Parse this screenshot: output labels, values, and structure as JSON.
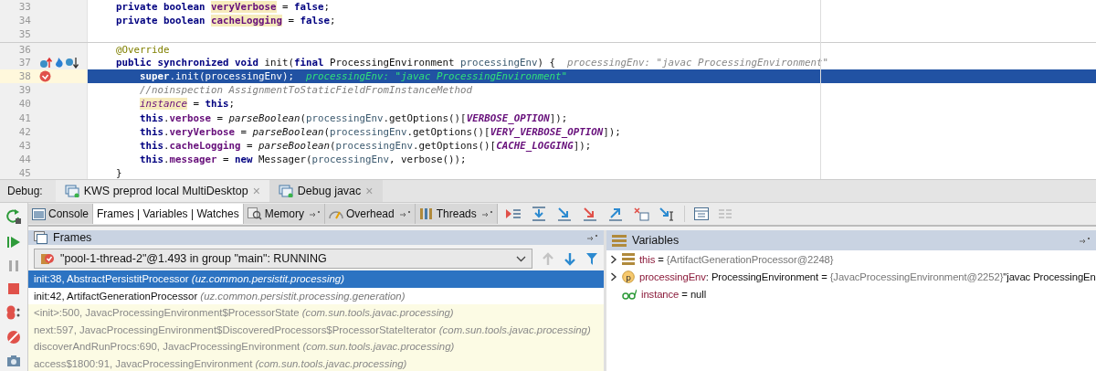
{
  "editor": {
    "lines": [
      {
        "number": "33",
        "kind": "member",
        "selected": false,
        "breakpoint": false,
        "method_markers": false,
        "segments": [
          {
            "kind": "kw",
            "text": "private boolean "
          },
          {
            "kind": "decl",
            "text": "veryVerbose"
          },
          {
            "kind": "plain",
            "text": " = "
          },
          {
            "kind": "kw",
            "text": "false"
          },
          {
            "kind": "plain",
            "text": ";"
          }
        ]
      },
      {
        "number": "34",
        "kind": "member",
        "selected": false,
        "breakpoint": false,
        "method_markers": false,
        "segments": [
          {
            "kind": "kw",
            "text": "private boolean "
          },
          {
            "kind": "decl",
            "text": "cacheLogging"
          },
          {
            "kind": "plain",
            "text": " = "
          },
          {
            "kind": "kw",
            "text": "false"
          },
          {
            "kind": "plain",
            "text": ";"
          }
        ]
      },
      {
        "number": "35",
        "kind": "member",
        "selected": false,
        "breakpoint": false,
        "method_markers": false
      },
      {
        "number": "36",
        "kind": "member",
        "selected": false,
        "breakpoint": false,
        "method_markers": false,
        "segments": [
          {
            "kind": "annotation",
            "text": "@Override"
          }
        ]
      },
      {
        "number": "37",
        "kind": "member",
        "selected": false,
        "breakpoint": false,
        "method_markers": true,
        "segments": [
          {
            "kind": "kw",
            "text": "public synchronized void "
          },
          {
            "kind": "plain",
            "text": "init("
          },
          {
            "kind": "kw",
            "text": "final "
          },
          {
            "kind": "plain",
            "text": "ProcessingEnvironment "
          },
          {
            "kind": "param",
            "text": "processingEnv"
          },
          {
            "kind": "plain",
            "text": ") {"
          },
          {
            "kind": "hint",
            "text": "processingEnv: \"javac ProcessingEnvironment\""
          }
        ]
      },
      {
        "number": "38",
        "kind": "body",
        "selected": true,
        "breakpoint": true,
        "method_markers": false,
        "segments": [
          {
            "kind": "kw",
            "text": "super"
          },
          {
            "kind": "plain",
            "text": ".init(processingEnv);"
          },
          {
            "kind": "hint",
            "text": "processingEnv: \"javac ProcessingEnvironment\""
          }
        ]
      },
      {
        "number": "39",
        "kind": "body",
        "selected": false,
        "breakpoint": false,
        "method_markers": false,
        "segments": [
          {
            "kind": "comment",
            "text": "//noinspection AssignmentToStaticFieldFromInstanceMethod"
          }
        ]
      },
      {
        "number": "40",
        "kind": "body",
        "selected": false,
        "breakpoint": false,
        "method_markers": false,
        "segments": [
          {
            "kind": "static-decl",
            "text": "instance"
          },
          {
            "kind": "plain",
            "text": " = "
          },
          {
            "kind": "kw",
            "text": "this"
          },
          {
            "kind": "plain",
            "text": ";"
          }
        ]
      },
      {
        "number": "41",
        "kind": "body",
        "selected": false,
        "breakpoint": false,
        "method_markers": false,
        "segments": [
          {
            "kind": "kw",
            "text": "this"
          },
          {
            "kind": "plain",
            "text": "."
          },
          {
            "kind": "field",
            "text": "verbose"
          },
          {
            "kind": "plain",
            "text": " = "
          },
          {
            "kind": "static-call",
            "text": "parseBoolean"
          },
          {
            "kind": "plain",
            "text": "("
          },
          {
            "kind": "param",
            "text": "processingEnv"
          },
          {
            "kind": "plain",
            "text": ".getOptions()["
          },
          {
            "kind": "const",
            "text": "VERBOSE_OPTION"
          },
          {
            "kind": "plain",
            "text": "]);"
          }
        ]
      },
      {
        "number": "42",
        "kind": "body",
        "selected": false,
        "breakpoint": false,
        "method_markers": false,
        "segments": [
          {
            "kind": "kw",
            "text": "this"
          },
          {
            "kind": "plain",
            "text": "."
          },
          {
            "kind": "field",
            "text": "veryVerbose"
          },
          {
            "kind": "plain",
            "text": " = "
          },
          {
            "kind": "static-call",
            "text": "parseBoolean"
          },
          {
            "kind": "plain",
            "text": "("
          },
          {
            "kind": "param",
            "text": "processingEnv"
          },
          {
            "kind": "plain",
            "text": ".getOptions()["
          },
          {
            "kind": "const",
            "text": "VERY_VERBOSE_OPTION"
          },
          {
            "kind": "plain",
            "text": "]);"
          }
        ]
      },
      {
        "number": "43",
        "kind": "body",
        "selected": false,
        "breakpoint": false,
        "method_markers": false,
        "segments": [
          {
            "kind": "kw",
            "text": "this"
          },
          {
            "kind": "plain",
            "text": "."
          },
          {
            "kind": "field",
            "text": "cacheLogging"
          },
          {
            "kind": "plain",
            "text": " = "
          },
          {
            "kind": "static-call",
            "text": "parseBoolean"
          },
          {
            "kind": "plain",
            "text": "("
          },
          {
            "kind": "param",
            "text": "processingEnv"
          },
          {
            "kind": "plain",
            "text": ".getOptions()["
          },
          {
            "kind": "const",
            "text": "CACHE_LOGGING"
          },
          {
            "kind": "plain",
            "text": "]);"
          }
        ]
      },
      {
        "number": "44",
        "kind": "body",
        "selected": false,
        "breakpoint": false,
        "method_markers": false,
        "segments": [
          {
            "kind": "kw",
            "text": "this"
          },
          {
            "kind": "plain",
            "text": "."
          },
          {
            "kind": "field",
            "text": "messager"
          },
          {
            "kind": "plain",
            "text": " = "
          },
          {
            "kind": "kw",
            "text": "new "
          },
          {
            "kind": "plain",
            "text": "Messager("
          },
          {
            "kind": "param",
            "text": "processingEnv"
          },
          {
            "kind": "plain",
            "text": ", verbose());"
          }
        ]
      },
      {
        "number": "45",
        "kind": "member",
        "selected": false,
        "breakpoint": false,
        "method_markers": false,
        "segments": [
          {
            "kind": "plain",
            "text": "}"
          }
        ]
      }
    ]
  },
  "debug": {
    "label": "Debug:",
    "tabs": [
      {
        "label": "KWS preprod local MultiDesktop",
        "close": "×",
        "selected": true
      },
      {
        "label": "Debug javac",
        "close": "×",
        "selected": false
      }
    ]
  },
  "toolbar": {
    "tabs": [
      {
        "label": "Console",
        "kind": "console",
        "pinned": false,
        "selected": false
      },
      {
        "label": "Frames | Variables | Watches",
        "kind": "frames",
        "pinned": false,
        "selected": true
      },
      {
        "label": "Memory",
        "kind": "memory",
        "pinned": true,
        "selected": false
      },
      {
        "label": "Overhead",
        "kind": "overhead",
        "pinned": true,
        "selected": false
      },
      {
        "label": "Threads",
        "kind": "threads",
        "pinned": true,
        "selected": false
      }
    ]
  },
  "frames": {
    "title": "Frames",
    "thread": "\"pool-1-thread-2\"@1.493 in group \"main\": RUNNING",
    "rows": [
      {
        "method": "init:38, AbstractPersistitProcessor",
        "package": "(uz.common.persistit.processing)",
        "kind": "user",
        "selected": true
      },
      {
        "method": "init:42, ArtifactGenerationProcessor",
        "package": "(uz.common.persistit.processing.generation)",
        "kind": "user",
        "selected": false
      },
      {
        "method": "<init>:500, JavacProcessingEnvironment$ProcessorState",
        "package": "(com.sun.tools.javac.processing)",
        "kind": "library",
        "selected": false
      },
      {
        "method": "next:597, JavacProcessingEnvironment$DiscoveredProcessors$ProcessorStateIterator",
        "package": "(com.sun.tools.javac.processing)",
        "kind": "library",
        "selected": false
      },
      {
        "method": "discoverAndRunProcs:690, JavacProcessingEnvironment",
        "package": "(com.sun.tools.javac.processing)",
        "kind": "library",
        "selected": false
      },
      {
        "method": "access$1800:91, JavacProcessingEnvironment",
        "package": "(com.sun.tools.javac.processing)",
        "kind": "library",
        "selected": false
      }
    ]
  },
  "variables": {
    "title": "Variables",
    "rows": [
      {
        "kind": "object",
        "expandable": true,
        "name": "this",
        "equals": "=",
        "value": "{ArtifactGenerationProcessor@2248}"
      },
      {
        "kind": "param",
        "badge": "p",
        "expandable": true,
        "name": "processingEnv",
        "type": ": ProcessingEnvironment",
        "equals": "=",
        "value": "{JavacProcessingEnvironment@2252}",
        "extra": "\"javac ProcessingEn"
      },
      {
        "kind": "watch",
        "expandable": false,
        "name": "instance",
        "equals": "=",
        "value": "null"
      }
    ]
  }
}
